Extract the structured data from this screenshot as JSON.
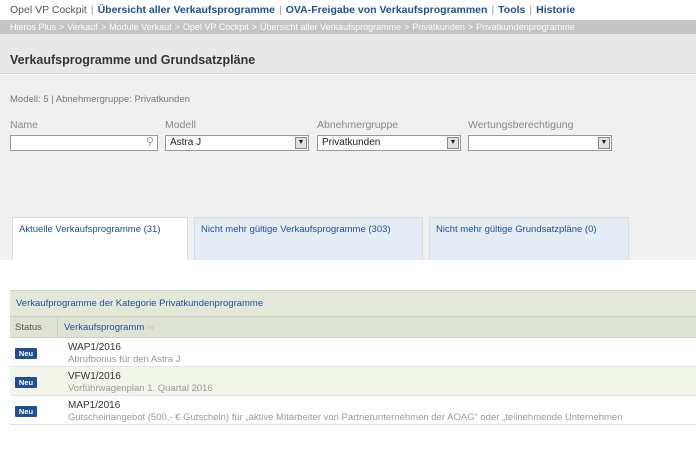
{
  "topnav": {
    "items": [
      {
        "label": "Opel VP Cockpit",
        "active": false
      },
      {
        "label": "Übersicht aller Verkaufsprogramme",
        "active": true
      },
      {
        "label": "OVA-Freigabe von Verkaufsprogrammen",
        "active": true
      },
      {
        "label": "Tools",
        "active": true
      },
      {
        "label": "Historie",
        "active": true
      }
    ],
    "separator": "|"
  },
  "breadcrumb": {
    "items": [
      "Hieros Plus",
      "Verkauf",
      "Module Verkauf",
      "Opel VP Cockpit",
      "Übersicht aller Verkaufsprogramme",
      "Privatkunden",
      "Privatkundenprogramme"
    ],
    "separator": ">"
  },
  "page": {
    "title": "Verkaufsprogramme und Grundsatzpläne"
  },
  "filters": {
    "summary": "Modell: 5 | Abnehmergruppe: Privatkunden",
    "name": {
      "label": "Name",
      "value": "",
      "icon": "search-icon"
    },
    "modell": {
      "label": "Modell",
      "value": "Astra J"
    },
    "abnehmergruppe": {
      "label": "Abnehmergruppe",
      "value": "Privatkunden"
    },
    "wertung": {
      "label": "Wertungsberechtigung",
      "value": ""
    }
  },
  "tabs": [
    {
      "label": "Aktuelle Verkaufsprogramme (31)",
      "active": true
    },
    {
      "label": "Nicht mehr gültige Verkaufsprogramme (303)",
      "active": false
    },
    {
      "label": "Nicht mehr gültige Grundsatzpläne (0)",
      "active": false
    }
  ],
  "table": {
    "caption": "Verkaufprogramme der Kategorie Privatkundenprogramme",
    "headers": {
      "status": "Status",
      "program": "Verkaufsprogramm"
    },
    "rows": [
      {
        "badge": "Neu",
        "code": "WAP1/2016",
        "description": "Abrufbonus für den Astra J"
      },
      {
        "badge": "Neu",
        "code": "VFW1/2016",
        "description": "Vorführwagenplan 1. Quartal 2016"
      },
      {
        "badge": "Neu",
        "code": "MAP1/2016",
        "description": "Gutscheinangebot (500,- € Gutschein) für „aktive Mitarbeiter von Partnerunternehmen der AOAG“ oder „teilnehmende Unternehmen"
      }
    ]
  },
  "colors": {
    "link": "#1f4f96",
    "badge": "#1f4f96",
    "titlebar": "#e8e8e8",
    "table_header": "#dfe3d6"
  }
}
